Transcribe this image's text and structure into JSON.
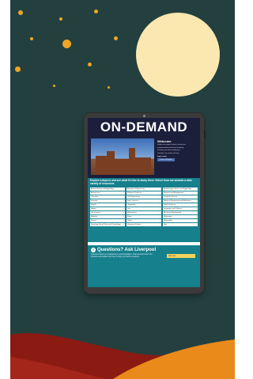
{
  "colors": {
    "sky": "#23403f",
    "moon": "#fbe8b0",
    "stars": "#f0a623",
    "hill_dark": "#8b1a12",
    "hill_orange": "#e98a1a",
    "header_bg": "#1b1f3b",
    "teal": "#16808c",
    "button_yellow": "#f5d35b"
  },
  "page": {
    "title": "ON-DEMAND"
  },
  "hero": {
    "welcome": "Welcome",
    "intro_lines": [
      "Explore our range of videos, virtual tours,",
      "and presentations from the University.",
      "",
      "Discover more about studying at",
      "Liverpool, our campus and city."
    ],
    "login_label": "Log in now",
    "login_button": "Login or Register"
  },
  "explore": {
    "title": "Explore a days in and see what it's like to study there. Select from our website a wide variety of resources.",
    "subjects": [
      "Ancient History and Egyptology",
      "Aerospace Engineering",
      "Archaeology, Classics and Egyptology",
      "Architecture",
      "Biological Sciences",
      "Business and Management",
      "Chemistry",
      "Civil Engineering",
      "Computer Science",
      "Dentistry",
      "Earth Sciences",
      "Electrical Engineering and Electronics",
      "English",
      "Geography",
      "Health Sciences",
      "History",
      "Law",
      "Languages and Cultures",
      "Life Sciences",
      "Mathematics",
      "Mechanical Engineering",
      "Medicine",
      "Music",
      "Philosophy",
      "Physics",
      "Politics",
      "Psychology",
      "Sociology, Social Policy and Criminology",
      "Veterinary Science",
      "Vets"
    ]
  },
  "questions": {
    "title": "Questions? Ask Liverpool",
    "button": "Ask now",
    "text": "Questions about our programmes, accommodation, finances and more? Our students and advisers are here to help you find the answers."
  }
}
